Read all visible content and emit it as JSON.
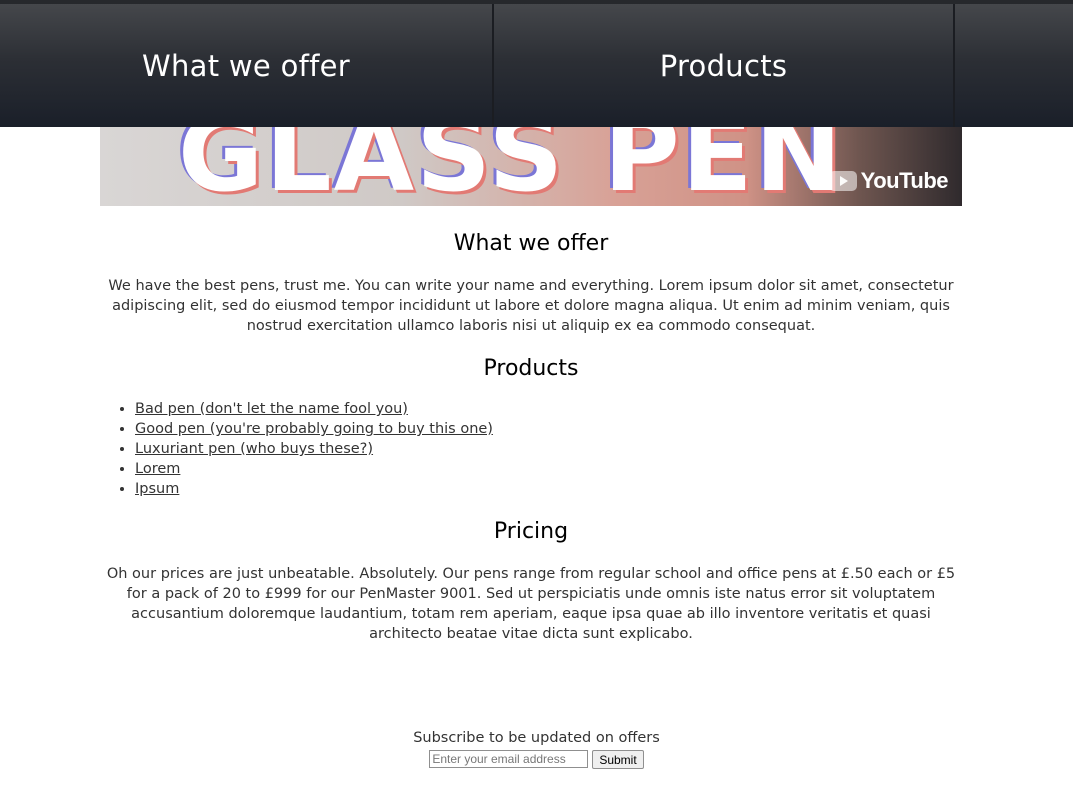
{
  "nav": {
    "items": [
      {
        "label": "What we offer"
      },
      {
        "label": "Products"
      },
      {
        "label": ""
      }
    ]
  },
  "hero": {
    "title": "GLASS PEN",
    "badge": "YouTube"
  },
  "sections": {
    "offer": {
      "heading": "What we offer",
      "body": "We have the best pens, trust me. You can write your name and everything. Lorem ipsum dolor sit amet, consectetur adipiscing elit, sed do eiusmod tempor incididunt ut labore et dolore magna aliqua. Ut enim ad minim veniam, quis nostrud exercitation ullamco laboris nisi ut aliquip ex ea commodo consequat."
    },
    "products": {
      "heading": "Products",
      "items": [
        "Bad pen (don't let the name fool you)",
        "Good pen (you're probably going to buy this one)",
        "Luxuriant pen (who buys these?)",
        "Lorem",
        "Ipsum"
      ]
    },
    "pricing": {
      "heading": "Pricing",
      "body": "Oh our prices are just unbeatable. Absolutely. Our pens range from regular school and office pens at £.50 each or £5 for a pack of 20 to £999 for our PenMaster 9001. Sed ut perspiciatis unde omnis iste natus error sit voluptatem accusantium doloremque laudantium, totam rem aperiam, eaque ipsa quae ab illo inventore veritatis et quasi architecto beatae vitae dicta sunt explicabo."
    }
  },
  "subscribe": {
    "label": "Subscribe to be updated on offers",
    "email_placeholder": "Enter your email address",
    "submit_label": "Submit"
  },
  "colors": {
    "nav_background": "#2c2f35",
    "nav_text": "#ffffff",
    "body_text": "#333333"
  }
}
